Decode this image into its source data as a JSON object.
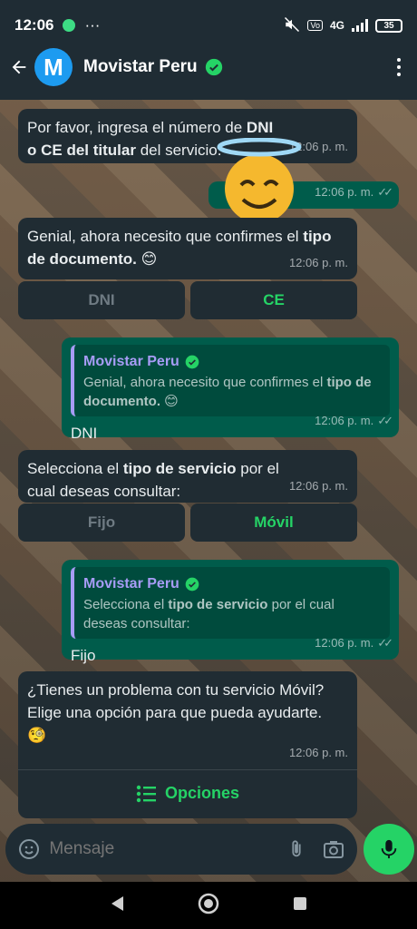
{
  "status_bar": {
    "time": "12:06",
    "more": "···",
    "network": "4G",
    "battery": "35"
  },
  "header": {
    "contact_name": "Movistar Peru",
    "avatar_letter": "M"
  },
  "messages": [
    {
      "type": "incoming",
      "parts": [
        "Por favor, ingresa el número de ",
        "DNI o CE del titular",
        " del servicio."
      ],
      "time": "12:06 p. m."
    },
    {
      "type": "outgoing_emoji",
      "time": "12:06 p. m."
    },
    {
      "type": "incoming",
      "parts": [
        "Genial, ahora necesito que confirmes el ",
        "tipo de documento.",
        " 😊"
      ],
      "time": "12:06 p. m."
    },
    {
      "type": "outgoing_reply",
      "quote_name": "Movistar Peru",
      "quote_parts": [
        "Genial, ahora necesito que confirmes el ",
        "tipo de documento.",
        " 😊"
      ],
      "text": "DNI",
      "time": "12:06 p. m."
    },
    {
      "type": "incoming",
      "parts": [
        "Selecciona el ",
        "tipo de servicio",
        " por el cual deseas consultar:"
      ],
      "time": "12:06 p. m."
    },
    {
      "type": "outgoing_reply",
      "quote_name": "Movistar Peru",
      "quote_parts": [
        "Selecciona el ",
        "tipo de servicio",
        " por el cual deseas consultar:"
      ],
      "text": "Fijo",
      "time": "12:06 p. m."
    },
    {
      "type": "incoming",
      "text": "¿Tienes un problema con tu servicio Móvil? Elige una opción para que pueda ayudarte. 🧐",
      "time": "12:06 p. m."
    }
  ],
  "quick_replies_1": [
    "DNI",
    "CE"
  ],
  "quick_replies_2": [
    "Fijo",
    "Móvil"
  ],
  "options_label": "Opciones",
  "input": {
    "placeholder": "Mensaje"
  }
}
